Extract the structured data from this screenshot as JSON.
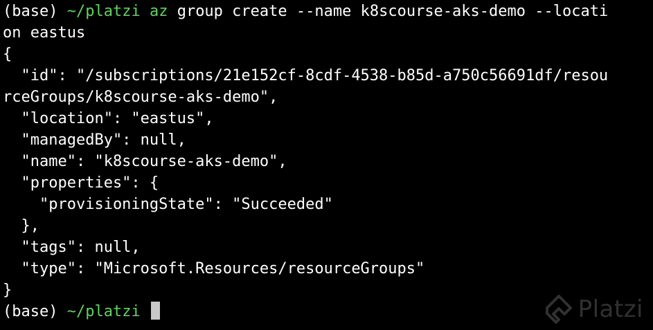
{
  "colors": {
    "background": "#000000",
    "text": "#ffffff",
    "prompt_path": "#5fd35f",
    "cursor": "#c8c8c8"
  },
  "prompt": {
    "env": "(base)",
    "path": "~/platzi"
  },
  "command": {
    "program": "az",
    "args_line1": " group create --name k8scourse-aks-demo --locati",
    "args_line2": "on eastus"
  },
  "output_lines": [
    "{",
    "  \"id\": \"/subscriptions/21e152cf-8cdf-4538-b85d-a750c56691df/resou",
    "rceGroups/k8scourse-aks-demo\",",
    "  \"location\": \"eastus\",",
    "  \"managedBy\": null,",
    "  \"name\": \"k8scourse-aks-demo\",",
    "  \"properties\": {",
    "    \"provisioningState\": \"Succeeded\"",
    "  },",
    "  \"tags\": null,",
    "  \"type\": \"Microsoft.Resources/resourceGroups\"",
    "}"
  ],
  "watermark": {
    "icon": "platzi-logo-icon",
    "text": "Platzi"
  }
}
